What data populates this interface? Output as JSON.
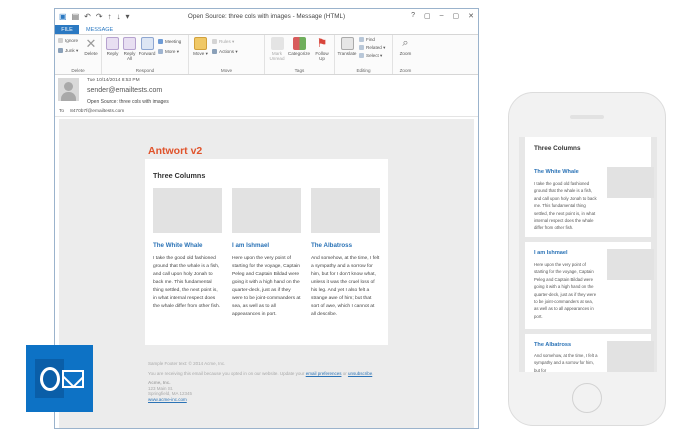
{
  "window": {
    "title": "Open Source: three cols with images - Message (HTML)",
    "controls": [
      "?",
      "▢",
      "–",
      "▢",
      "✕"
    ]
  },
  "tabs": {
    "file": "FILE",
    "message": "MESSAGE"
  },
  "ribbon": {
    "groups": {
      "delete": "Delete",
      "respond": "Respond",
      "move": "Move",
      "tags": "Tags",
      "editing": "Editing",
      "zoom": "Zoom"
    },
    "ignore": "Ignore",
    "junk": "Junk",
    "delete": "Delete",
    "reply": "Reply",
    "reply_all": "Reply All",
    "forward": "Forward",
    "meeting": "Meeting",
    "more": "More",
    "move": "Move",
    "rules": "Rules",
    "actions": "Actions",
    "mark_unread": "Mark Unread",
    "categorize": "Categorize",
    "follow_up": "Follow Up",
    "translate": "Translate",
    "find": "Find",
    "related": "Related",
    "select": "Select",
    "zoom": "Zoom"
  },
  "message": {
    "date": "Tue 10/14/2014 8:53 PM",
    "from": "sender@emailtests.com",
    "subject": "Open Source: three cols with images",
    "to_label": "To",
    "to": "8470b7f@emailtests.com"
  },
  "email": {
    "heading": "Antwort v2",
    "section_title": "Three Columns",
    "columns": [
      {
        "title": "The White Whale",
        "text": "I take the good old fashioned ground that the whale is a fish, and call upon holy Jonah to back me. This fundamental thing settled, the next point is, in what internal respect does the whale differ from other fish."
      },
      {
        "title": "I am Ishmael",
        "text": "Here upon the very point of starting for the voyage, Captain Peleg and Captain Bildad were going it with a high hand on the quarter-deck, just as if they were to be joint-commanders at sea, as well as to all appearances in port."
      },
      {
        "title": "The Albatross",
        "text": "And somehow, at the time, I felt a sympathy and a sorrow for him, but for I don't know what, unless it was the cruel loss of his leg. And yet I also felt a strange awe of him; but that sort of awe, which I cannot at all describe."
      }
    ],
    "footer": {
      "sample": "Sample Footer text: © 2014 Acme, Inc.",
      "notice_pre": "You are receiving this email because you opted in on our website. Update your ",
      "prefs_link": "email preferences",
      "notice_mid": " or ",
      "unsub_link": "unsubscribe",
      "notice_post": ".",
      "company": "Acme, Inc.",
      "street": "123 Main St.",
      "city": "Springfield, MA 12345",
      "website": "www.acme-inc.com"
    }
  },
  "phone": {
    "section_title": "Three Columns",
    "items": [
      {
        "title": "The White Whale",
        "text": "I take the good old fashioned ground that the whale is a fish, and call upon holy Jonah to back me. This fundamental thing settled, the next point is, in what internal respect does the whale differ from other fish."
      },
      {
        "title": "I am Ishmael",
        "text": "Here upon the very point of starting for the voyage, Captain Peleg and Captain Bildad were going it with a high hand on the quarter-deck, just as if they were to be joint-commanders at sea, as well as to all appearances in port."
      },
      {
        "title": "The Albatross",
        "text": "And somehow, at the time, I felt a sympathy and a sorrow for him, but for"
      }
    ]
  },
  "colors": {
    "accent": "#2b79c2",
    "heading": "#e0532b",
    "logo": "#0d72c5"
  }
}
